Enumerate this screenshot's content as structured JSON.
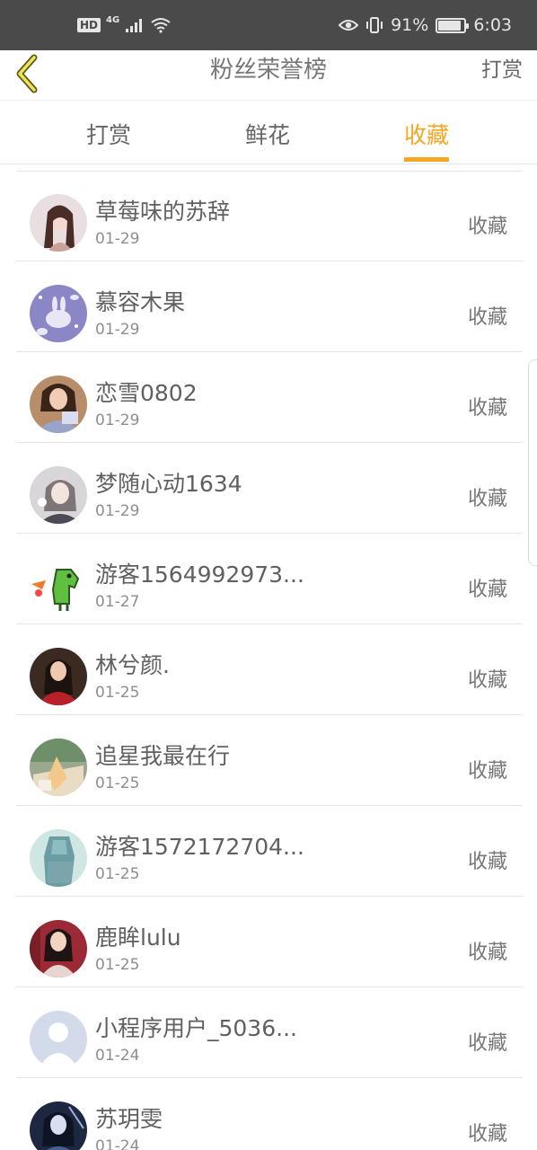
{
  "status_bar": {
    "hd": "HD",
    "network": "4G",
    "battery_percent": "91%",
    "battery_level": 0.91,
    "time": "6:03",
    "icons": [
      "signal-icon",
      "wifi-icon",
      "eye-icon",
      "vibrate-icon",
      "battery-icon"
    ]
  },
  "nav": {
    "title": "粉丝荣誉榜",
    "right_label": "打赏",
    "back_icon": "chevron-left-icon",
    "accent": "#f5a623"
  },
  "tabs": [
    {
      "label": "打赏",
      "active": false
    },
    {
      "label": "鲜花",
      "active": false
    },
    {
      "label": "收藏",
      "active": true
    }
  ],
  "list": [
    {
      "name": "草莓味的苏辞",
      "date": "01-29",
      "action": "收藏"
    },
    {
      "name": "慕容木果",
      "date": "01-29",
      "action": "收藏"
    },
    {
      "name": "恋雪0802",
      "date": "01-29",
      "action": "收藏"
    },
    {
      "name": "梦随心动1634",
      "date": "01-29",
      "action": "收藏"
    },
    {
      "name": "游客1564992973...",
      "date": "01-27",
      "action": "收藏"
    },
    {
      "name": "林兮颜.",
      "date": "01-25",
      "action": "收藏"
    },
    {
      "name": "追星我最在行",
      "date": "01-25",
      "action": "收藏"
    },
    {
      "name": "游客1572172704...",
      "date": "01-25",
      "action": "收藏"
    },
    {
      "name": "鹿眸lulu",
      "date": "01-25",
      "action": "收藏"
    },
    {
      "name": "小程序用户_5036...",
      "date": "01-24",
      "action": "收藏"
    },
    {
      "name": "苏玥雯",
      "date": "01-24",
      "action": "收藏"
    }
  ]
}
